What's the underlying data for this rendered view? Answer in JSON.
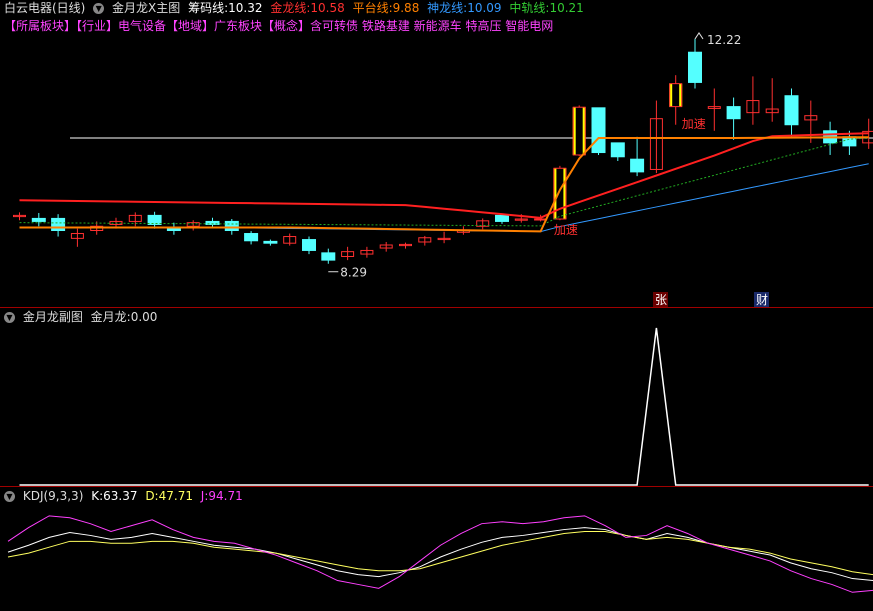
{
  "header": {
    "stock": "白云电器(日线)",
    "indicator": "金月龙X主图",
    "chouma": {
      "label": "筹码线:",
      "value": "10.32"
    },
    "jinlong": {
      "label": "金龙线:",
      "value": "10.58"
    },
    "pingtai": {
      "label": "平台线:",
      "value": "9.88"
    },
    "shenlong": {
      "label": "神龙线:",
      "value": "10.09"
    },
    "zhonggui": {
      "label": "中轨线:",
      "value": "10.21"
    }
  },
  "sectors": "【所属板块】【行业】电气设备【地域】广东板块【概念】含可转债 铁路基建 新能源车 特高压 智能电网",
  "sub": {
    "title": "金月龙副图",
    "label": "金月龙:",
    "value": "0.00"
  },
  "kdj": {
    "title": "KDJ(9,3,3)",
    "k_label": "K:",
    "k": "63.37",
    "d_label": "D:",
    "d": "47.71",
    "j_label": "J:",
    "j": "94.71"
  },
  "annotations": {
    "high": "12.22",
    "low": "8.29",
    "accel1": "加速",
    "accel2": "加速",
    "zhang": "张",
    "cai": "财"
  },
  "colors": {
    "up": "#ff3030",
    "down": "#54ffff",
    "jinlong": "#ff2020",
    "pingtai": "#ff8000",
    "shenlong": "#3399ff",
    "zhonggui": "#22aa22",
    "white": "#ffffff",
    "k": "#ffffff",
    "d": "#ffff60",
    "j": "#ff40ff",
    "signal": "#ffff00"
  },
  "chart_data": [
    {
      "type": "candlestick",
      "title": "金月龙X主图",
      "ylim": [
        7.9,
        12.5
      ],
      "candles": [
        [
          9.28,
          9.3,
          9.22,
          9.35
        ],
        [
          9.25,
          9.2,
          9.12,
          9.34
        ],
        [
          9.25,
          9.05,
          8.95,
          9.32
        ],
        [
          8.92,
          9.0,
          8.78,
          9.08
        ],
        [
          9.05,
          9.12,
          8.98,
          9.2
        ],
        [
          9.15,
          9.2,
          9.08,
          9.26
        ],
        [
          9.2,
          9.3,
          9.12,
          9.35
        ],
        [
          9.3,
          9.15,
          9.08,
          9.36
        ],
        [
          9.1,
          9.05,
          8.98,
          9.18
        ],
        [
          9.12,
          9.18,
          9.05,
          9.22
        ],
        [
          9.2,
          9.15,
          9.1,
          9.26
        ],
        [
          9.2,
          9.05,
          8.98,
          9.24
        ],
        [
          9.0,
          8.88,
          8.82,
          9.04
        ],
        [
          8.87,
          8.84,
          8.8,
          8.9
        ],
        [
          8.84,
          8.95,
          8.8,
          9.0
        ],
        [
          8.9,
          8.72,
          8.66,
          8.95
        ],
        [
          8.68,
          8.56,
          8.5,
          8.75
        ],
        [
          8.62,
          8.7,
          8.56,
          8.78
        ],
        [
          8.66,
          8.72,
          8.6,
          8.78
        ],
        [
          8.76,
          8.81,
          8.7,
          8.86
        ],
        [
          8.8,
          8.82,
          8.75,
          8.85
        ],
        [
          8.86,
          8.93,
          8.8,
          8.96
        ],
        [
          8.9,
          8.92,
          8.84,
          9.03
        ],
        [
          9.02,
          9.06,
          8.98,
          9.12
        ],
        [
          9.12,
          9.21,
          9.07,
          9.25
        ],
        [
          9.3,
          9.2,
          9.16,
          9.33
        ],
        [
          9.22,
          9.24,
          9.18,
          9.32
        ],
        [
          9.24,
          9.24,
          9.2,
          9.31
        ],
        [
          9.24,
          10.08,
          9.22,
          10.12
        ],
        [
          10.3,
          11.09,
          10.28,
          11.12
        ],
        [
          11.08,
          10.34,
          10.3,
          10.57
        ],
        [
          10.5,
          10.27,
          10.2,
          10.5
        ],
        [
          10.23,
          10.02,
          9.95,
          10.6
        ],
        [
          10.06,
          10.9,
          10.0,
          11.2
        ],
        [
          11.1,
          11.48,
          10.8,
          11.62
        ],
        [
          12.0,
          11.5,
          11.4,
          12.22
        ],
        [
          11.07,
          11.1,
          10.7,
          11.4
        ],
        [
          11.1,
          10.9,
          10.55,
          11.25
        ],
        [
          11.0,
          11.2,
          10.8,
          11.6
        ],
        [
          11.0,
          11.06,
          10.85,
          11.57
        ],
        [
          11.28,
          10.8,
          10.6,
          11.4
        ],
        [
          10.88,
          10.95,
          10.5,
          11.2
        ],
        [
          10.7,
          10.5,
          10.3,
          10.85
        ],
        [
          10.6,
          10.45,
          10.3,
          10.7
        ],
        [
          10.5,
          10.69,
          10.4,
          10.9
        ]
      ],
      "series": [
        {
          "name": "金龙线",
          "values": [
            10.58
          ]
        },
        {
          "name": "平台线",
          "values": [
            9.88
          ]
        },
        {
          "name": "神龙线",
          "values": [
            10.09
          ]
        },
        {
          "name": "中轨线",
          "values": [
            10.21
          ]
        },
        {
          "name": "筹码线",
          "values": [
            10.32
          ]
        }
      ]
    },
    {
      "type": "line",
      "title": "金月龙副图",
      "series": [
        {
          "name": "金月龙",
          "values": [
            0,
            0,
            0,
            0,
            0,
            0,
            0,
            0,
            0,
            0,
            0,
            0,
            0,
            0,
            0,
            0,
            0,
            0,
            0,
            0,
            0,
            0,
            0,
            0,
            0,
            0,
            0,
            0,
            0,
            0,
            0,
            0,
            0,
            1,
            0,
            0,
            0,
            0,
            0,
            0,
            0,
            0,
            0,
            0,
            0
          ]
        }
      ]
    },
    {
      "type": "line",
      "title": "KDJ(9,3,3)",
      "ylim": [
        0,
        100
      ],
      "series": [
        {
          "name": "K",
          "values": [
            55,
            62,
            70,
            75,
            72,
            68,
            70,
            74,
            70,
            66,
            62,
            60,
            58,
            54,
            48,
            42,
            36,
            32,
            30,
            34,
            40,
            50,
            58,
            65,
            70,
            72,
            75,
            78,
            80,
            78,
            72,
            68,
            74,
            70,
            64,
            60,
            56,
            52,
            44,
            38,
            34,
            28,
            26
          ]
        },
        {
          "name": "D",
          "values": [
            50,
            54,
            60,
            66,
            66,
            64,
            64,
            66,
            66,
            64,
            60,
            58,
            56,
            54,
            50,
            46,
            42,
            38,
            36,
            36,
            38,
            44,
            50,
            56,
            62,
            66,
            70,
            74,
            76,
            76,
            72,
            68,
            70,
            68,
            64,
            60,
            58,
            54,
            48,
            44,
            40,
            35,
            32
          ]
        },
        {
          "name": "J",
          "values": [
            66,
            80,
            92,
            90,
            84,
            76,
            82,
            88,
            78,
            70,
            66,
            64,
            58,
            52,
            44,
            36,
            26,
            22,
            18,
            30,
            46,
            62,
            74,
            84,
            86,
            84,
            86,
            90,
            92,
            82,
            70,
            72,
            82,
            74,
            64,
            58,
            52,
            46,
            36,
            28,
            22,
            14,
            16
          ]
        }
      ]
    }
  ]
}
